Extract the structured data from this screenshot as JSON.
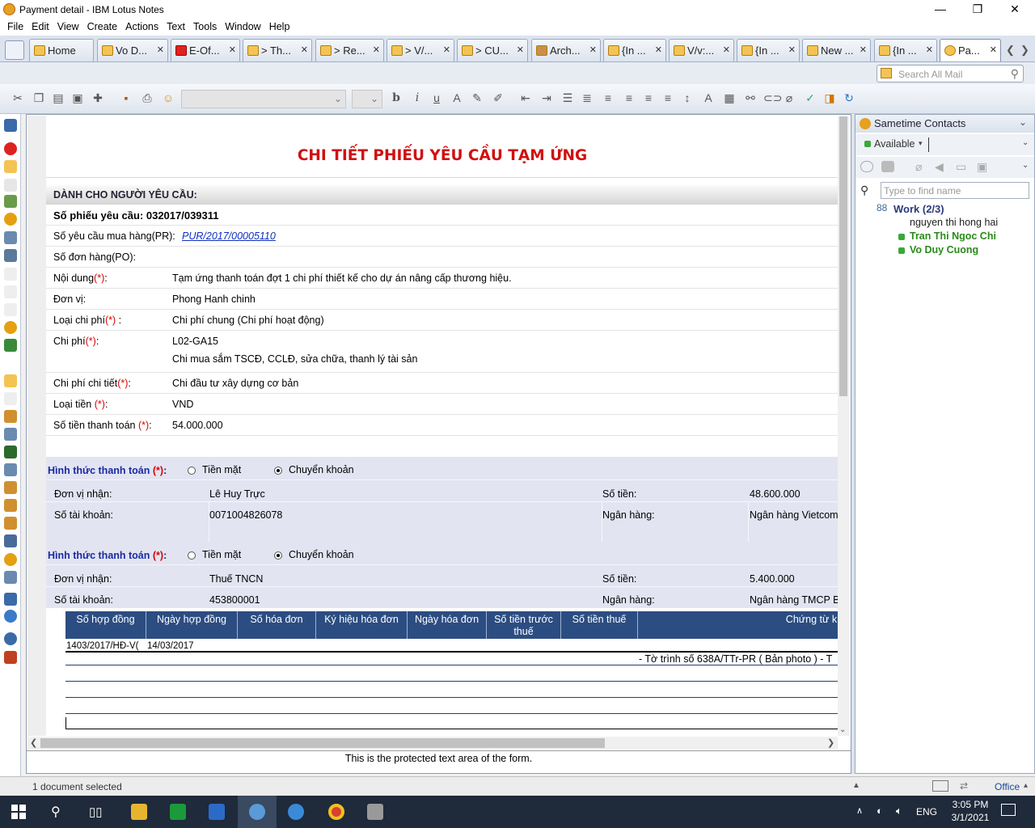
{
  "window": {
    "title": "Payment detail - IBM Lotus Notes"
  },
  "menu": [
    "File",
    "Edit",
    "View",
    "Create",
    "Actions",
    "Text",
    "Tools",
    "Window",
    "Help"
  ],
  "tabs": [
    "Home",
    "Vo D...",
    "E-Of...",
    "> Th...",
    "> Re...",
    "> V/...",
    "> CU...",
    "Arch...",
    "{In ...",
    "V/v:...",
    "{In ...",
    "New ...",
    "{In ...",
    "Pa..."
  ],
  "search": {
    "placeholder": "Search All Mail"
  },
  "form": {
    "title": "CHI TIẾT PHIẾU YÊU CẦU TẠM ỨNG",
    "section": "DÀNH CHO NGƯỜI YÊU CẦU:",
    "request_no_label": "Số phiếu yêu cầu: 032017/039311",
    "pr_label": "Số yêu cầu mua hàng(PR):",
    "pr_value": "PUR/2017/00005110",
    "po_label": "Số đơn hàng(PO):",
    "content_label": "Nội dung",
    "content_value": "Tạm ứng thanh toán đợt 1 chi phí thiết kế cho dự án nâng cấp thương hiệu.",
    "unit_label": "Đơn vị:",
    "unit_value": "Phong Hanh chinh",
    "costtype_label": "Loại chi phí",
    "costtype_value": "Chi phí chung (Chi phí hoạt động)",
    "cost_label": "Chi phí",
    "cost_code": "L02-GA15",
    "cost_desc": "Chi mua sắm TSCĐ, CCLĐ, sửa chữa, thanh lý tài sản",
    "costdetail_label": "Chi phí chi tiết",
    "costdetail_value": "Chi đầu tư xây dựng cơ bản",
    "currency_label": "Loại tiền",
    "currency_value": "VND",
    "amount_label": "Số tiền thanh toán",
    "amount_value": "54.000.000",
    "req_mark": "(*)",
    "colon": ":",
    "colon_sp": " :"
  },
  "payments": [
    {
      "label": "Hình thức thanh toán",
      "opt1": "Tiền mặt",
      "opt2": "Chuyển khoản",
      "recv_label": "Đơn vị nhận:",
      "recv": "Lê Huy Trực",
      "amt_label": "Số tiền:",
      "amt": "48.600.000",
      "acct_label": "Số tài khoản:",
      "acct": "0071004826078",
      "bank_label": "Ngân hàng:",
      "bank": "Ngân hàng Vietcom"
    },
    {
      "label": "Hình thức thanh toán",
      "opt1": "Tiền mặt",
      "opt2": "Chuyển khoản",
      "recv_label": "Đơn vị nhận:",
      "recv": "Thuế TNCN",
      "amt_label": "Số tiền:",
      "amt": "5.400.000",
      "acct_label": "Số tài khoản:",
      "acct": "453800001",
      "bank_label": "Ngân hàng:",
      "bank": "Ngân hàng TMCP B"
    }
  ],
  "invoice_table": {
    "headers": [
      "Số hợp đồng",
      "Ngày hợp đồng",
      "Số hóa đơn",
      "Ký hiệu hóa đơn",
      "Ngày hóa đơn",
      "Số tiền trước thuế",
      "Số tiền thuế",
      "Chứng từ khá"
    ],
    "row_contract": "1403/2017/HĐ-V(",
    "row_date": "14/03/2017",
    "row_note": "- Tờ trình số 638A/TTr-PR ( Bản photo ) - T"
  },
  "protected_text": "This is the protected text area of the form.",
  "sametime": {
    "title": "Sametime Contacts",
    "status": "Available",
    "find_placeholder": "Type to find name",
    "group": "Work (2/3)",
    "contacts": [
      "nguyen thi hong hai",
      "Tran Thi Ngoc Chi",
      "Vo Duy Cuong"
    ]
  },
  "statusbar": {
    "text": "1 document selected",
    "location": "Office"
  },
  "taskbar": {
    "lang": "ENG",
    "time": "3:05 PM",
    "date": "3/1/2021"
  }
}
